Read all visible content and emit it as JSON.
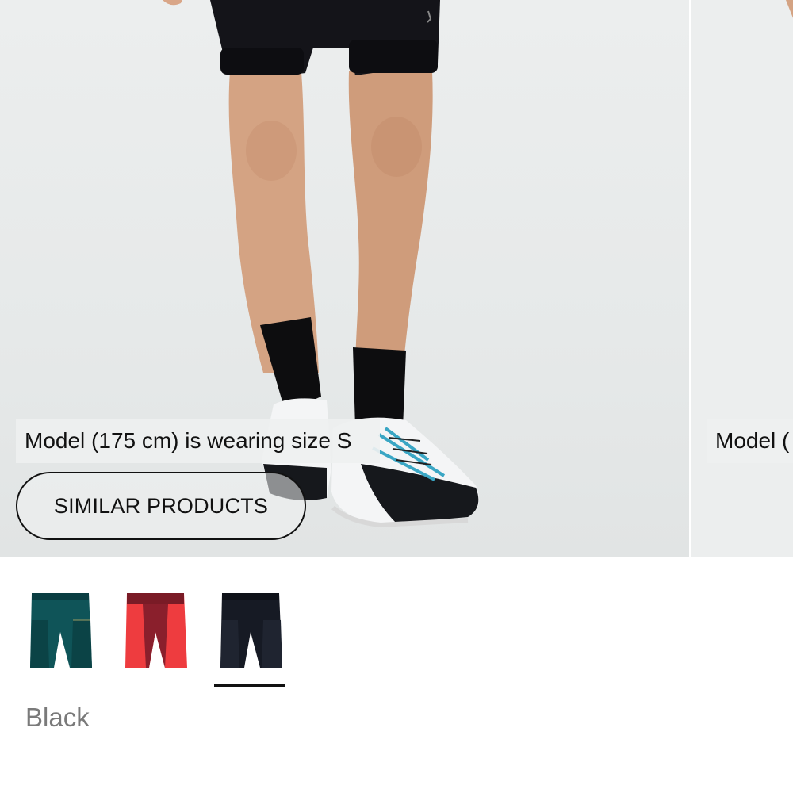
{
  "gallery": {
    "size_note": "Model (175 cm) is wearing size S",
    "next_size_note": "Model (",
    "similar_button_label": "SIMILAR PRODUCTS"
  },
  "swatches": [
    {
      "name": "Teal",
      "color": "#0f5458",
      "selected": false
    },
    {
      "name": "Red",
      "color": "#ee3c3f",
      "selected": false
    },
    {
      "name": "Black",
      "color": "#161a24",
      "selected": true
    }
  ],
  "selected_color_name": "Black"
}
